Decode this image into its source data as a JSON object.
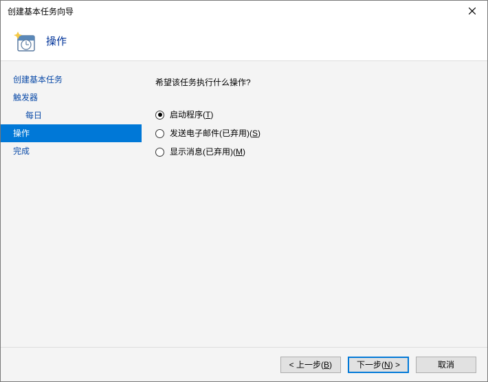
{
  "titlebar": {
    "title": "创建基本任务向导"
  },
  "header": {
    "caption": "操作"
  },
  "sidebar": {
    "steps": {
      "create": "创建基本任务",
      "trigger": "触发器",
      "daily": "每日",
      "action": "操作",
      "finish": "完成"
    }
  },
  "content": {
    "question": "希望该任务执行什么操作?",
    "options": {
      "start_program": {
        "text": "启动程序(",
        "mnemonic": "T",
        "suffix": ")"
      },
      "send_email": {
        "text": "发送电子邮件(已弃用)(",
        "mnemonic": "S",
        "suffix": ")"
      },
      "show_message": {
        "text": "显示消息(已弃用)(",
        "mnemonic": "M",
        "suffix": ")"
      }
    }
  },
  "footer": {
    "back": {
      "pre": "< 上一步(",
      "mnemonic": "B",
      "suf": ")"
    },
    "next": {
      "pre": "下一步(",
      "mnemonic": "N",
      "suf": ") >"
    },
    "cancel": {
      "label": "取消"
    }
  }
}
